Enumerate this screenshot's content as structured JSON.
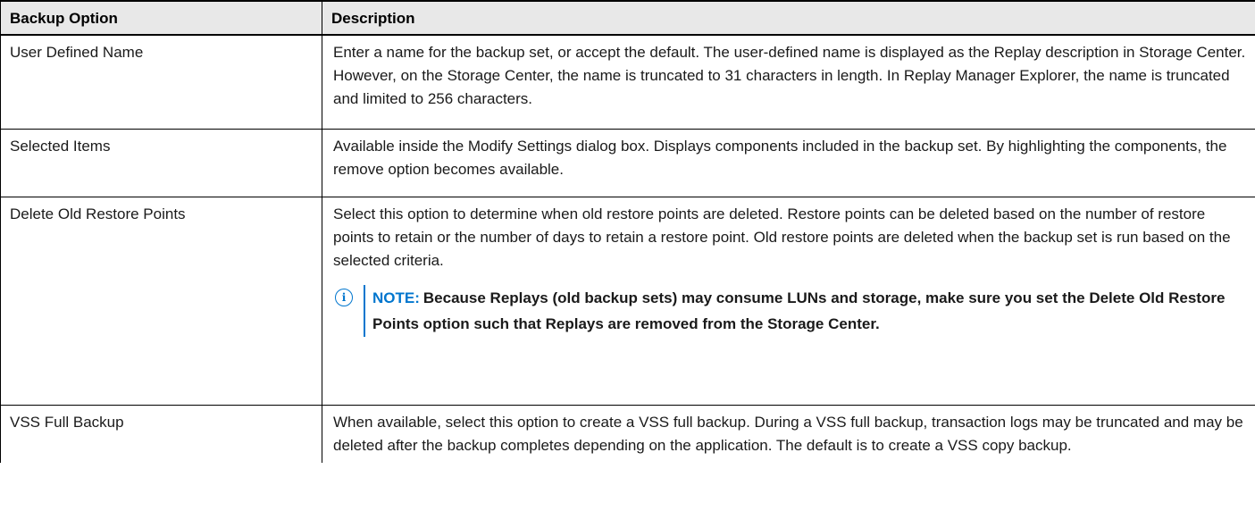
{
  "table": {
    "headers": [
      "Backup Option",
      "Description"
    ],
    "rows": [
      {
        "option": "User Defined Name",
        "description": "Enter a name for the backup set, or accept the default. The user-defined name is displayed as the Replay description in Storage Center. However, on the Storage Center, the name is truncated to 31 characters in length. In Replay Manager Explorer, the name is truncated and limited to 256 characters."
      },
      {
        "option": "Selected Items",
        "description": "Available inside the Modify Settings dialog box. Displays components included in the backup set. By highlighting the components, the remove option becomes available."
      },
      {
        "option": "Delete Old Restore Points",
        "description": "Select this option to determine when old restore points are deleted. Restore points can be deleted based on the number of restore points to retain or the number of days to retain a restore point. Old restore points are deleted when the backup set is run based on the selected criteria.",
        "note": {
          "label": "NOTE:",
          "text": "Because Replays (old backup sets) may consume LUNs and storage, make sure you set the Delete Old Restore Points option such that Replays are removed from the Storage Center."
        }
      },
      {
        "option": "VSS Full Backup",
        "description": "When available, select this option to create a VSS full backup. During a VSS full backup, transaction logs may be truncated and may be deleted after the backup completes depending on the application. The default is to create a VSS copy backup."
      }
    ]
  },
  "icons": {
    "note_icon": "info-circle-icon",
    "note_glyph": "i"
  },
  "colors": {
    "note_accent": "#0076ce",
    "header_background": "#e8e8e8",
    "border": "#000000"
  }
}
